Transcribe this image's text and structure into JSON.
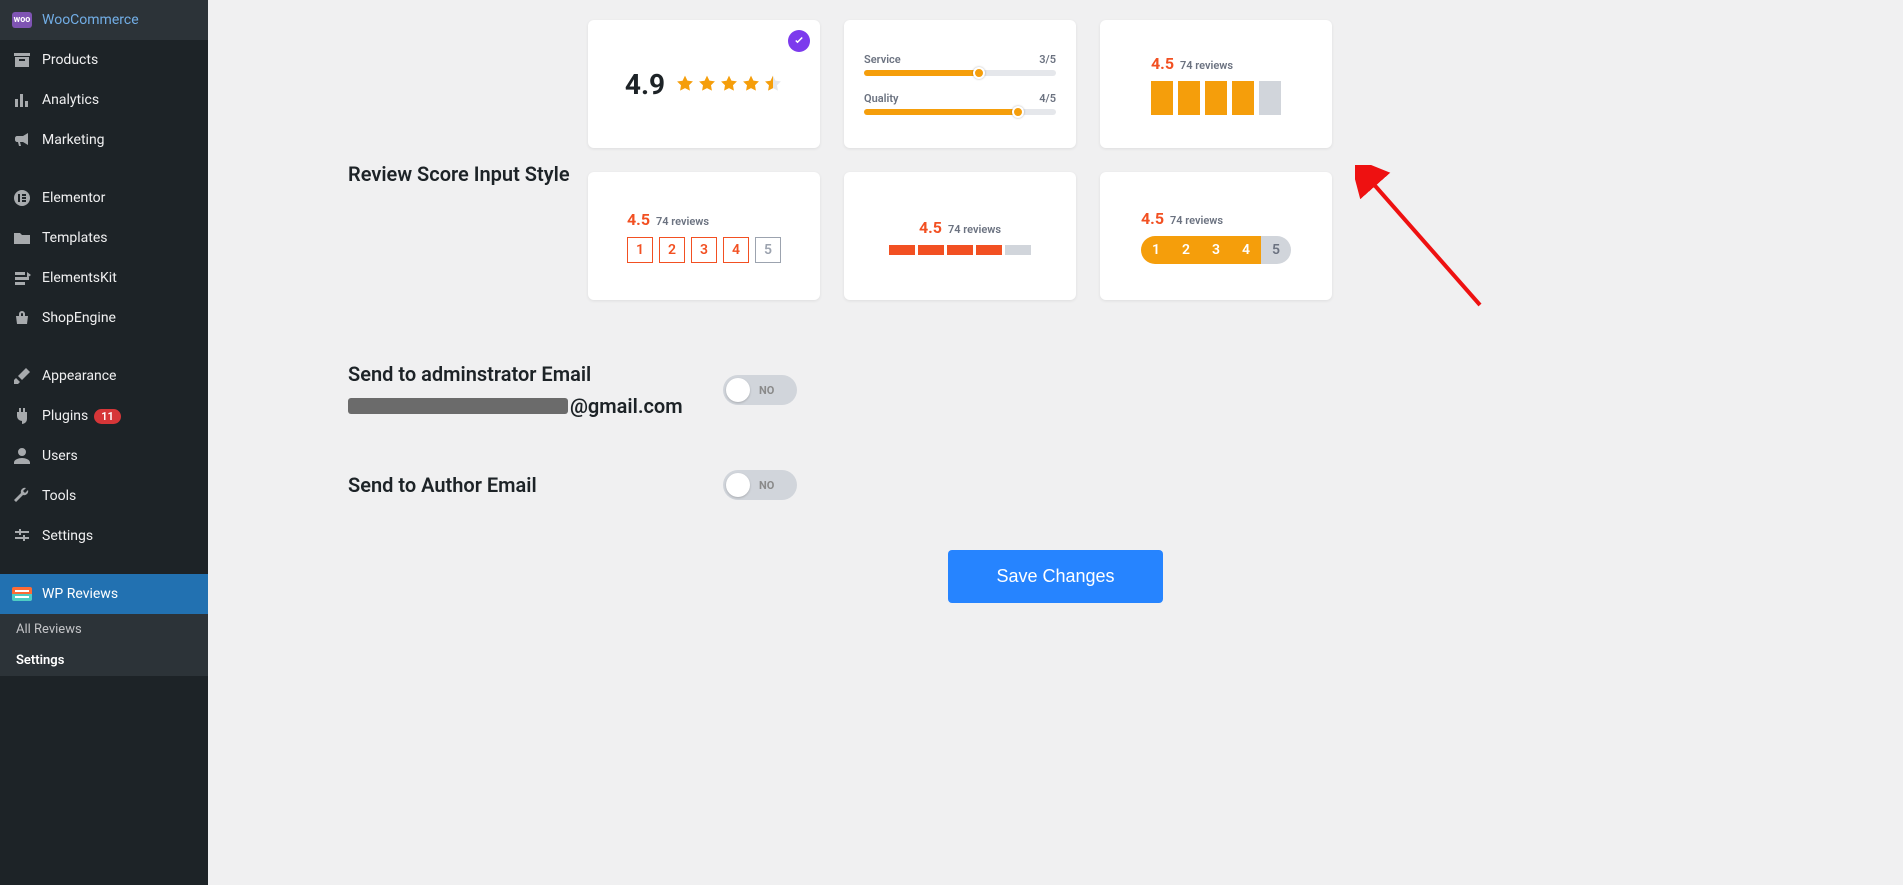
{
  "sidebar": {
    "items": [
      {
        "label": "WooCommerce",
        "icon": "woo"
      },
      {
        "label": "Products",
        "icon": "archive"
      },
      {
        "label": "Analytics",
        "icon": "chart"
      },
      {
        "label": "Marketing",
        "icon": "megaphone"
      },
      {
        "label": "Elementor",
        "icon": "elementor"
      },
      {
        "label": "Templates",
        "icon": "folder"
      },
      {
        "label": "ElementsKit",
        "icon": "ekit"
      },
      {
        "label": "ShopEngine",
        "icon": "basket"
      },
      {
        "label": "Appearance",
        "icon": "brush"
      },
      {
        "label": "Plugins",
        "icon": "plug",
        "badge": "11"
      },
      {
        "label": "Users",
        "icon": "user"
      },
      {
        "label": "Tools",
        "icon": "wrench"
      },
      {
        "label": "Settings",
        "icon": "sliders"
      },
      {
        "label": "WP Reviews",
        "icon": "wpreviews",
        "active": true
      }
    ],
    "submenu": [
      {
        "label": "All Reviews"
      },
      {
        "label": "Settings",
        "active": true
      }
    ]
  },
  "settings": {
    "review_score_label": "Review Score Input Style",
    "styles": {
      "card1": {
        "score": "4.9"
      },
      "card2": {
        "row1_label": "Service",
        "row1_value": "3/5",
        "row1_pct": 60,
        "row2_label": "Quality",
        "row2_value": "4/5",
        "row2_pct": 80
      },
      "card3": {
        "score": "4.5",
        "sub": "74 reviews"
      },
      "card4": {
        "score": "4.5",
        "sub": "74 reviews",
        "n1": "1",
        "n2": "2",
        "n3": "3",
        "n4": "4",
        "n5": "5"
      },
      "card5": {
        "score": "4.5",
        "sub": "74 reviews"
      },
      "card6": {
        "score": "4.5",
        "sub": "74 reviews",
        "n1": "1",
        "n2": "2",
        "n3": "3",
        "n4": "4",
        "n5": "5"
      }
    },
    "admin_email_label": "Send to adminstrator Email",
    "admin_email_suffix": "@gmail.com",
    "author_email_label": "Send to Author Email",
    "toggle_no": "NO",
    "save_label": "Save Changes"
  }
}
